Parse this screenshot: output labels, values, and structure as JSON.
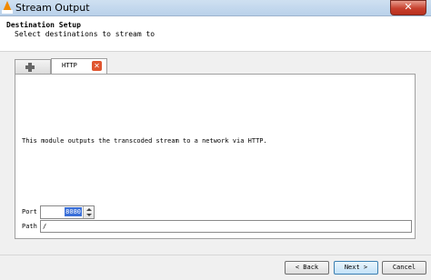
{
  "window": {
    "title": "Stream Output",
    "close_label": "✕"
  },
  "header": {
    "title": "Destination Setup",
    "subtitle": "Select destinations to stream to"
  },
  "tabs": {
    "add_icon": "plus-icon",
    "active_label": "HTTP",
    "close_icon": "✕"
  },
  "panel": {
    "description": "This module outputs the transcoded stream to a network via HTTP.",
    "port_label": "Port",
    "port_value": "8080",
    "path_label": "Path",
    "path_value": "/"
  },
  "buttons": {
    "back": "< Back",
    "next": "Next >",
    "cancel": "Cancel"
  },
  "colors": {
    "close_button": "#c7402e",
    "port_highlight": "#3a6fd8",
    "tab_close": "#e0552f"
  }
}
